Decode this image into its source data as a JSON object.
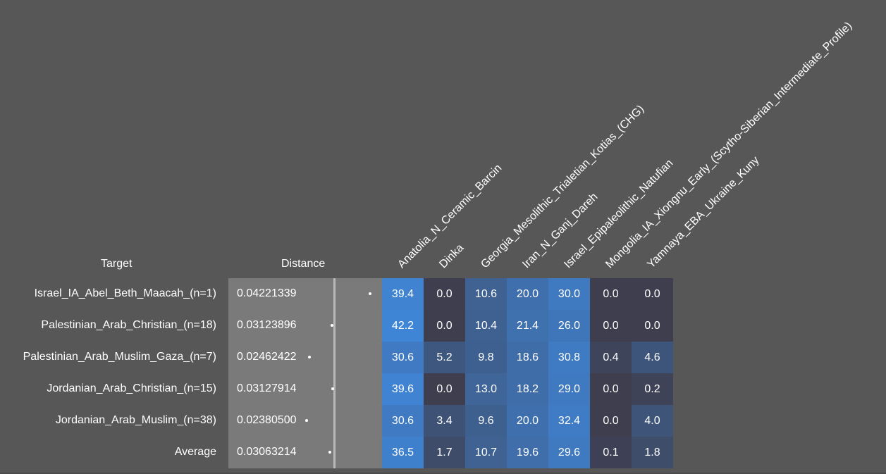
{
  "headers": {
    "target": "Target",
    "distance": "Distance"
  },
  "columns": [
    "Anatolia_N_Ceramic_Barcin",
    "Dinka",
    "Georgia_Mesolithic_Trialetian_Kotias_(CHG)",
    "Iran_N_Ganj_Dareh",
    "Israel_Epipaleolithic_Natufian",
    "Mongolia_IA_Xiongnu_Early_(Scytho-Siberian_Intermediate_Profile)",
    "Yamnaya_EBA_Ukraine_Kuny"
  ],
  "rows": [
    {
      "name": "Israel_IA_Abel_Beth_Maacah_(n=1)",
      "distance": "0.04221339",
      "values": [
        "39.4",
        "0.0",
        "10.6",
        "20.0",
        "30.0",
        "0.0",
        "0.0"
      ]
    },
    {
      "name": "Palestinian_Arab_Christian_(n=18)",
      "distance": "0.03123896",
      "values": [
        "42.2",
        "0.0",
        "10.4",
        "21.4",
        "26.0",
        "0.0",
        "0.0"
      ]
    },
    {
      "name": "Palestinian_Arab_Muslim_Gaza_(n=7)",
      "distance": "0.02462422",
      "values": [
        "30.6",
        "5.2",
        "9.8",
        "18.6",
        "30.8",
        "0.4",
        "4.6"
      ]
    },
    {
      "name": "Jordanian_Arab_Christian_(n=15)",
      "distance": "0.03127914",
      "values": [
        "39.6",
        "0.0",
        "13.0",
        "18.2",
        "29.0",
        "0.0",
        "0.2"
      ]
    },
    {
      "name": "Jordanian_Arab_Muslim_(n=38)",
      "distance": "0.02380500",
      "values": [
        "30.6",
        "3.4",
        "9.6",
        "20.0",
        "32.4",
        "0.0",
        "4.0"
      ]
    },
    {
      "name": "Average",
      "distance": "0.03063214",
      "values": [
        "36.5",
        "1.7",
        "10.7",
        "19.6",
        "29.6",
        "0.1",
        "1.8"
      ]
    }
  ],
  "colors": {
    "background": "#575757",
    "distance_panel": "#7a7a7a",
    "distance_reference_line": "#b9b9b9",
    "heat_low": "#3e3e4e",
    "heat_high": "#3f85d6"
  }
}
